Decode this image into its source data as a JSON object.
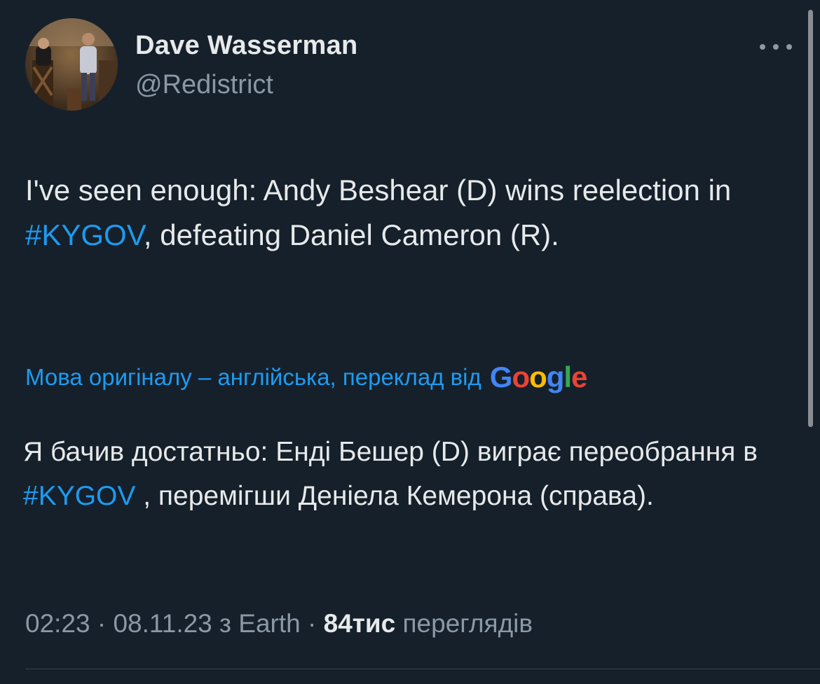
{
  "author": {
    "display_name": "Dave Wasserman",
    "handle": "@Redistrict"
  },
  "menu": {
    "icon": "more-horizontal-icon"
  },
  "tweet": {
    "text_before": "I've seen enough: Andy Beshear (D) wins reelection in ",
    "hashtag": "#KYGOV",
    "text_after": ", defeating Daniel Cameron (R)."
  },
  "translation": {
    "notice": "Мова оригіналу – англійська, переклад від",
    "provider_logo": "Google",
    "text_before": "Я бачив достатньо: Енді Бешер (D) виграє переобрання в ",
    "hashtag": "#KYGOV",
    "text_after": " , перемігши Деніела Кемерона (справа)."
  },
  "meta": {
    "time": "02:23",
    "separator": " · ",
    "date": "08.11.23",
    "source": "з Earth",
    "views_count": "84тис",
    "views_label": "переглядів"
  },
  "colors": {
    "background": "#15202b",
    "text": "#e7e9ea",
    "secondary": "#8b98a5",
    "link": "#1d9bf0"
  }
}
